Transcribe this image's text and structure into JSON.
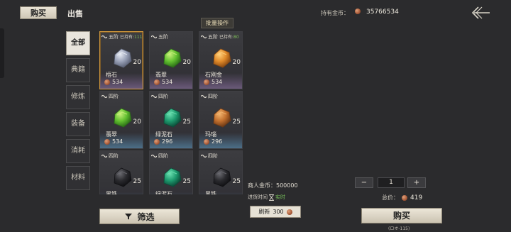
{
  "tabs": {
    "buy": "购买",
    "sell": "出售"
  },
  "wallet": {
    "label": "持有金币：",
    "value": "35766534"
  },
  "categories": [
    "全部",
    "典籍",
    "修炼",
    "装备",
    "消耗",
    "材料"
  ],
  "batch_label": "批量操作",
  "items": [
    {
      "grade": "五阶",
      "owned_label": "已持有:",
      "owned": "111",
      "name": "梧石",
      "qty": "20",
      "price": "534",
      "gem": "silver",
      "selected": true,
      "strip": "#6b5a7a"
    },
    {
      "grade": "五阶",
      "owned_label": "",
      "owned": "",
      "name": "翡翠",
      "qty": "20",
      "price": "534",
      "gem": "green",
      "selected": false,
      "strip": "#6b5a7a"
    },
    {
      "grade": "五阶",
      "owned_label": "已持有:",
      "owned": "80",
      "name": "石刚金",
      "qty": "20",
      "price": "534",
      "gem": "orange",
      "selected": false,
      "strip": "#6b5a7a"
    },
    {
      "grade": "四阶",
      "owned_label": "",
      "owned": "",
      "name": "翡翠",
      "qty": "20",
      "price": "534",
      "gem": "green",
      "selected": false,
      "strip": "#4c6f88"
    },
    {
      "grade": "四阶",
      "owned_label": "",
      "owned": "",
      "name": "绿泥石",
      "qty": "25",
      "price": "296",
      "gem": "teal",
      "selected": false,
      "strip": "#4c6f88"
    },
    {
      "grade": "四阶",
      "owned_label": "",
      "owned": "",
      "name": "玛瑙",
      "qty": "25",
      "price": "296",
      "gem": "amber",
      "selected": false,
      "strip": "#4c6f88"
    },
    {
      "grade": "四阶",
      "owned_label": "",
      "owned": "",
      "name": "黑铁",
      "qty": "25",
      "price": "",
      "gem": "black",
      "selected": false,
      "strip": "#4c6f88"
    },
    {
      "grade": "四阶",
      "owned_label": "",
      "owned": "",
      "name": "绿泥石",
      "qty": "25",
      "price": "",
      "gem": "teal",
      "selected": false,
      "strip": "#4c6f88"
    },
    {
      "grade": "四阶",
      "owned_label": "",
      "owned": "",
      "name": "黑铁",
      "qty": "25",
      "price": "",
      "gem": "black",
      "selected": false,
      "strip": "#4c6f88"
    }
  ],
  "filter_label": "筛选",
  "merchant": {
    "label": "商人金币：",
    "value": "500000"
  },
  "restock": {
    "label": "进货时间",
    "state": "实时"
  },
  "refresh": {
    "label": "刷新",
    "cost": "300"
  },
  "quantity": {
    "minus": "−",
    "value": "1",
    "plus": "+"
  },
  "total": {
    "label": "总价：",
    "value": "419"
  },
  "buy_label": "购买",
  "coords": "(ロオ-115)"
}
